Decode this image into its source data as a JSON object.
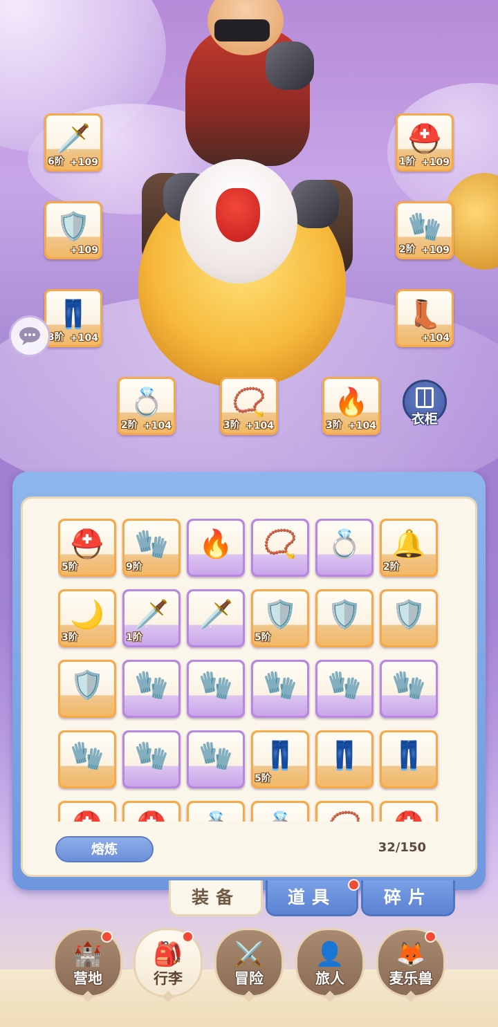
{
  "equipped": {
    "weapon": {
      "icon": "sword-icon",
      "tier": "6阶",
      "plus": "+109"
    },
    "helmet": {
      "icon": "helmet-icon",
      "tier": "1阶",
      "plus": "+109"
    },
    "armor": {
      "icon": "armor-icon",
      "tier": "",
      "plus": "+109"
    },
    "gloves": {
      "icon": "gauntlet-icon",
      "tier": "2阶",
      "plus": "+109"
    },
    "pants": {
      "icon": "pants-icon",
      "tier": "3阶",
      "plus": "+104"
    },
    "boots": {
      "icon": "boots-icon",
      "tier": "",
      "plus": "+104"
    },
    "ring": {
      "icon": "ring-icon",
      "tier": "2阶",
      "plus": "+104"
    },
    "necklace": {
      "icon": "necklace-icon",
      "tier": "3阶",
      "plus": "+104"
    },
    "charm": {
      "icon": "charm-icon",
      "tier": "3阶",
      "plus": "+104"
    }
  },
  "wardrobe": {
    "label": "衣柜",
    "icon": "wardrobe-icon"
  },
  "chat": {
    "icon": "chat-bubble-icon"
  },
  "inventory": {
    "rows": [
      [
        {
          "icon": "helmet-icon",
          "tier": "5阶",
          "rarity": "orange"
        },
        {
          "icon": "gauntlet-icon",
          "tier": "9阶",
          "rarity": "orange"
        },
        {
          "icon": "charm-icon",
          "tier": "",
          "rarity": "purple"
        },
        {
          "icon": "necklace-icon",
          "tier": "",
          "rarity": "purple"
        },
        {
          "icon": "ring-icon",
          "tier": "",
          "rarity": "purple"
        },
        {
          "icon": "bell-necklace-icon",
          "tier": "2阶",
          "rarity": "orange"
        }
      ],
      [
        {
          "icon": "horn-charm-icon",
          "tier": "3阶",
          "rarity": "orange"
        },
        {
          "icon": "sword-icon",
          "tier": "1阶",
          "rarity": "purple"
        },
        {
          "icon": "sword-icon",
          "tier": "",
          "rarity": "purple"
        },
        {
          "icon": "armor-icon",
          "tier": "5阶",
          "rarity": "orange"
        },
        {
          "icon": "armor-icon",
          "tier": "",
          "rarity": "orange"
        },
        {
          "icon": "armor-icon",
          "tier": "",
          "rarity": "orange"
        }
      ],
      [
        {
          "icon": "armor-icon",
          "tier": "",
          "rarity": "orange"
        },
        {
          "icon": "gauntlet-icon",
          "tier": "",
          "rarity": "purple"
        },
        {
          "icon": "gauntlet-icon",
          "tier": "",
          "rarity": "purple"
        },
        {
          "icon": "gauntlet-icon",
          "tier": "",
          "rarity": "purple"
        },
        {
          "icon": "gauntlet-icon",
          "tier": "",
          "rarity": "purple"
        },
        {
          "icon": "gauntlet-icon",
          "tier": "",
          "rarity": "purple"
        }
      ],
      [
        {
          "icon": "gauntlet-icon",
          "tier": "",
          "rarity": "orange"
        },
        {
          "icon": "gauntlet-icon",
          "tier": "",
          "rarity": "purple"
        },
        {
          "icon": "gauntlet-icon",
          "tier": "",
          "rarity": "purple"
        },
        {
          "icon": "pants-icon",
          "tier": "5阶",
          "rarity": "orange"
        },
        {
          "icon": "pants-icon",
          "tier": "",
          "rarity": "orange"
        },
        {
          "icon": "pants-icon",
          "tier": "",
          "rarity": "orange"
        }
      ],
      [
        {
          "icon": "helmet-icon",
          "tier": "",
          "rarity": "orange"
        },
        {
          "icon": "helmet-icon",
          "tier": "",
          "rarity": "orange"
        },
        {
          "icon": "ring-icon",
          "tier": "",
          "rarity": "orange"
        },
        {
          "icon": "ring-icon",
          "tier": "",
          "rarity": "orange"
        },
        {
          "icon": "necklace-icon",
          "tier": "",
          "rarity": "orange"
        },
        {
          "icon": "helmet-icon",
          "tier": "",
          "rarity": "orange"
        }
      ]
    ],
    "smelt_label": "熔炼",
    "capacity": "32/150"
  },
  "tabs": [
    {
      "label": "装备",
      "active": true,
      "badge": false
    },
    {
      "label": "道具",
      "active": false,
      "badge": true
    },
    {
      "label": "碎片",
      "active": false,
      "badge": false
    }
  ],
  "nav": [
    {
      "label": "营地",
      "icon": "castle-icon",
      "active": false,
      "badge": true
    },
    {
      "label": "行李",
      "icon": "backpack-icon",
      "active": true,
      "badge": true
    },
    {
      "label": "冒险",
      "icon": "crossed-swords-icon",
      "active": false,
      "badge": false
    },
    {
      "label": "旅人",
      "icon": "traveler-icon",
      "active": false,
      "badge": false
    },
    {
      "label": "麦乐兽",
      "icon": "pet-icon",
      "active": false,
      "badge": true
    }
  ],
  "colors": {
    "orange_rarity": "#f6a94a",
    "purple_rarity": "#b887e0",
    "panel_blue": "#6f97df",
    "badge_red": "#f14a37"
  }
}
